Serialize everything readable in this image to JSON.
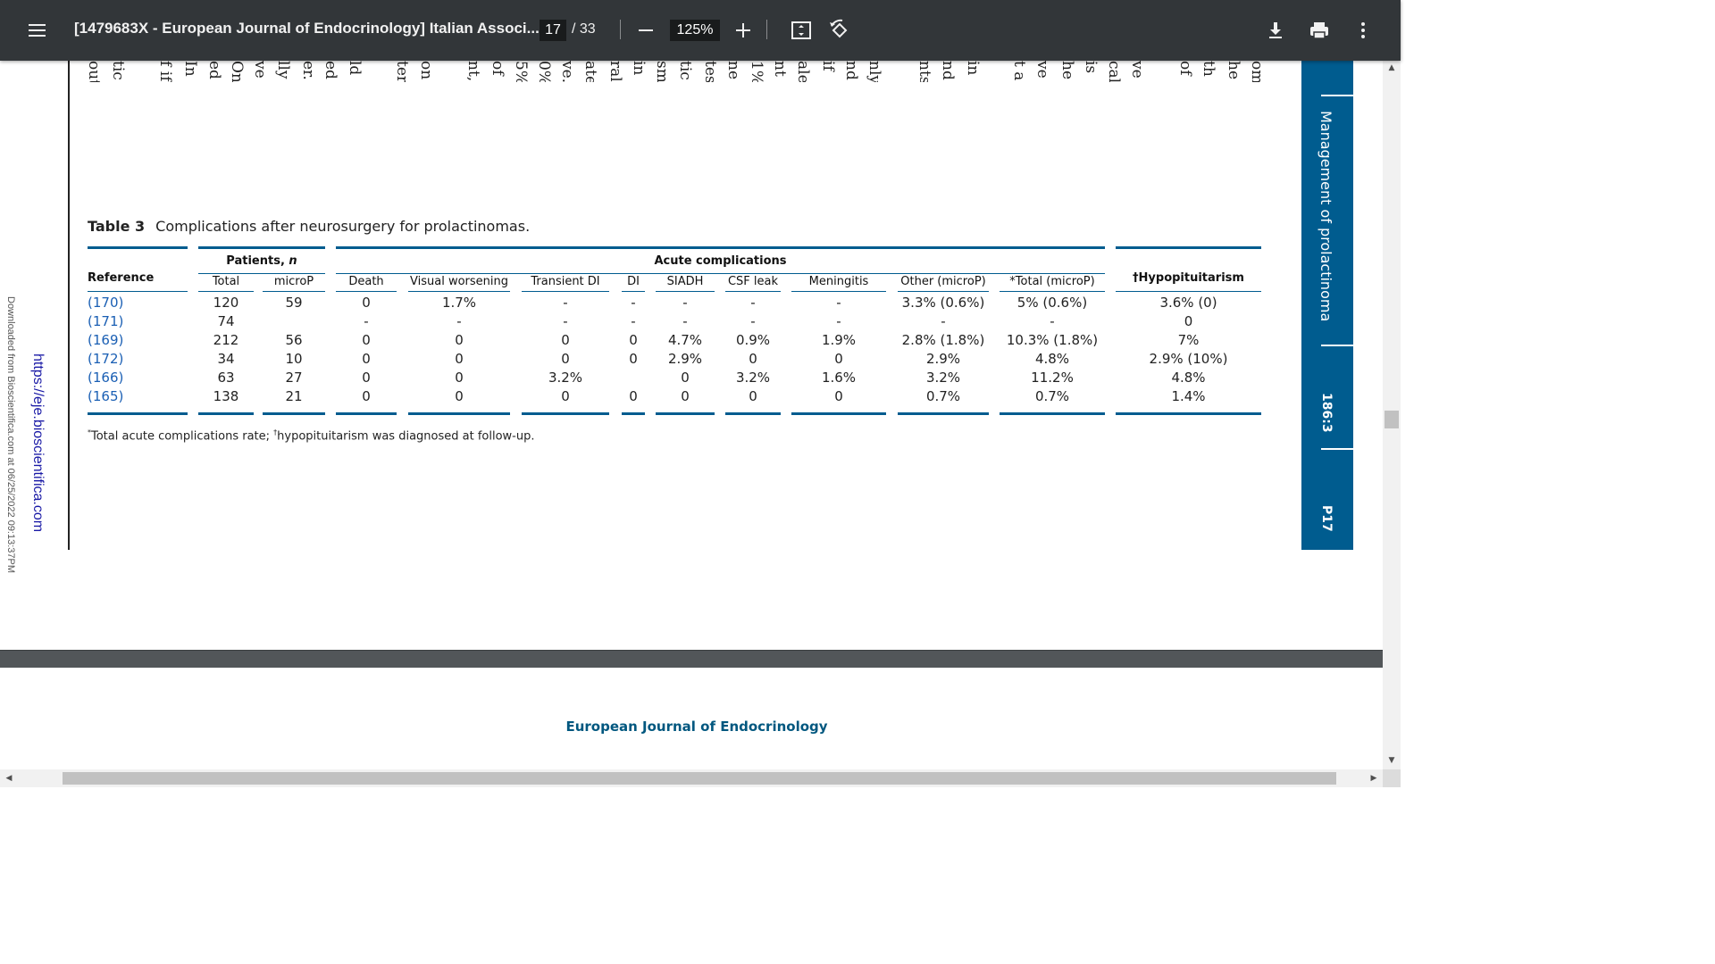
{
  "toolbar": {
    "title": "[1479683X - European Journal of Endocrinology] Italian Associ...",
    "current_page": "17",
    "total_pages": "/ 33",
    "zoom": "125%"
  },
  "vertical_text_fragments": [
    "out",
    "tic",
    "f if",
    "In",
    "ed",
    "On",
    "ve",
    "lly",
    "er.",
    "ed",
    "ld",
    "ter",
    "on",
    "nt,",
    "of",
    "5%",
    "0%",
    "ve.",
    "ate",
    "ral",
    "in",
    "sm",
    "tic",
    "tes",
    "ne",
    "1%",
    "nt",
    "ale",
    "if",
    "nd",
    "nly",
    "nts",
    "nd",
    "in",
    "t a",
    "ve",
    "he",
    "is",
    "cal",
    "ve",
    "of",
    "th",
    "he",
    "om"
  ],
  "margin": {
    "download_text": "Downloaded from Bioscientifica.com at 06/25/2022 09:13:37PM",
    "link_text": "https://eje.bioscientifica.com"
  },
  "side_tab": {
    "title": "Management of prolactinoma",
    "volume": "186:3",
    "page": "P17"
  },
  "table": {
    "caption_label": "Table 3",
    "caption_text": "Complications after neurosurgery for prolactinomas.",
    "reference_header": "Reference",
    "patients_group": "Patients, n",
    "acute_group": "Acute complications",
    "hypopit_header": "†Hypopituitarism",
    "columns": [
      "Total",
      "microP",
      "Death",
      "Visual worsening",
      "Transient DI",
      "DI",
      "SIADH",
      "CSF leak",
      "Meningitis",
      "Other (microP)",
      "*Total (microP)"
    ],
    "rows": [
      {
        "ref": "(170)",
        "cells": [
          "120",
          "59",
          "0",
          "1.7%",
          "-",
          "-",
          "-",
          "-",
          "-",
          "3.3% (0.6%)",
          "5% (0.6%)",
          "3.6% (0)"
        ]
      },
      {
        "ref": "(171)",
        "cells": [
          "74",
          "",
          "-",
          "-",
          "-",
          "-",
          "-",
          "-",
          "-",
          "-",
          "-",
          "0"
        ]
      },
      {
        "ref": "(169)",
        "cells": [
          "212",
          "56",
          "0",
          "0",
          "0",
          "0",
          "4.7%",
          "0.9%",
          "1.9%",
          "2.8% (1.8%)",
          "10.3% (1.8%)",
          "7%"
        ]
      },
      {
        "ref": "(172)",
        "cells": [
          "34",
          "10",
          "0",
          "0",
          "0",
          "0",
          "2.9%",
          "0",
          "0",
          "2.9%",
          "4.8%",
          "2.9% (10%)"
        ]
      },
      {
        "ref": "(166)",
        "cells": [
          "63",
          "27",
          "0",
          "0",
          "3.2%",
          "",
          "0",
          "3.2%",
          "1.6%",
          "3.2%",
          "11.2%",
          "4.8%"
        ]
      },
      {
        "ref": "(165)",
        "cells": [
          "138",
          "21",
          "0",
          "0",
          "0",
          "0",
          "0",
          "0",
          "0",
          "0.7%",
          "0.7%",
          "1.4%"
        ]
      }
    ],
    "footnote": "*Total acute complications rate; †hypopituitarism was diagnosed at follow-up."
  },
  "footer": {
    "journal": "European Journal of Endocrinology"
  }
}
